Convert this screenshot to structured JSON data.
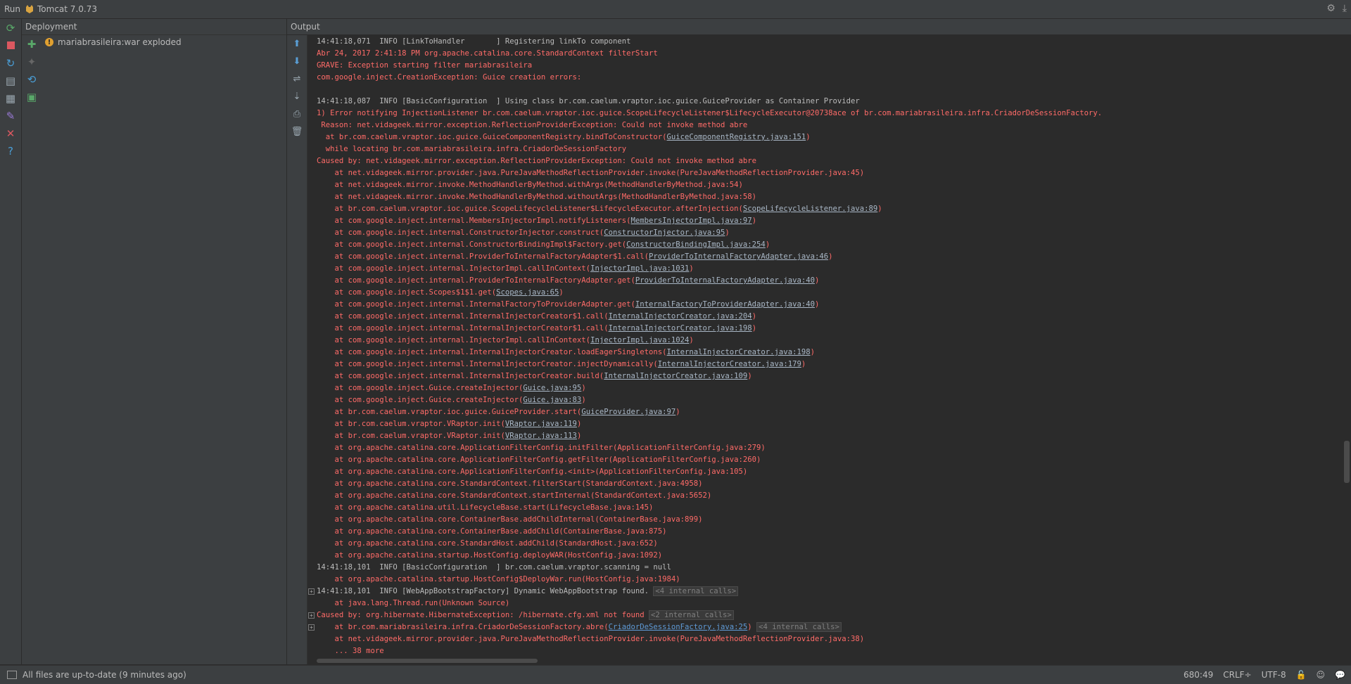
{
  "window": {
    "run_label": "Run",
    "config_name": "Tomcat 7.0.73"
  },
  "deployment": {
    "header": "Deployment",
    "items": [
      {
        "label": "mariabrasileira:war exploded"
      }
    ]
  },
  "output": {
    "header": "Output"
  },
  "console": [
    {
      "cls": "info",
      "text": "14:41:18,071  INFO [LinkToHandler       ] Registering linkTo component"
    },
    {
      "cls": "err",
      "text": "Abr 24, 2017 2:41:18 PM org.apache.catalina.core.StandardContext filterStart"
    },
    {
      "cls": "err",
      "text": "GRAVE: Exception starting filter mariabrasileira"
    },
    {
      "cls": "err",
      "text": "com.google.inject.CreationException: Guice creation errors:"
    },
    {
      "cls": "err",
      "text": ""
    },
    {
      "cls": "info",
      "text": "14:41:18,087  INFO [BasicConfiguration  ] Using class br.com.caelum.vraptor.ioc.guice.GuiceProvider as Container Provider"
    },
    {
      "cls": "err",
      "text": "1) Error notifying InjectionListener br.com.caelum.vraptor.ioc.guice.ScopeLifecycleListener$LifecycleExecutor@20738ace of br.com.mariabrasileira.infra.CriadorDeSessionFactory."
    },
    {
      "cls": "err",
      "text": " Reason: net.vidageek.mirror.exception.ReflectionProviderException: Could not invoke method abre"
    },
    {
      "cls": "err",
      "text": "  at br.com.caelum.vraptor.ioc.guice.GuiceComponentRegistry.bindToConstructor(",
      "link": "GuiceComponentRegistry.java:151",
      "tail": ")"
    },
    {
      "cls": "err",
      "text": "  while locating br.com.mariabrasileira.infra.CriadorDeSessionFactory"
    },
    {
      "cls": "err",
      "text": "Caused by: net.vidageek.mirror.exception.ReflectionProviderException: Could not invoke method abre"
    },
    {
      "cls": "err",
      "text": "    at net.vidageek.mirror.provider.java.PureJavaMethodReflectionProvider.invoke(PureJavaMethodReflectionProvider.java:45)"
    },
    {
      "cls": "err",
      "text": "    at net.vidageek.mirror.invoke.MethodHandlerByMethod.withArgs(MethodHandlerByMethod.java:54)"
    },
    {
      "cls": "err",
      "text": "    at net.vidageek.mirror.invoke.MethodHandlerByMethod.withoutArgs(MethodHandlerByMethod.java:58)"
    },
    {
      "cls": "err",
      "text": "    at br.com.caelum.vraptor.ioc.guice.ScopeLifecycleListener$LifecycleExecutor.afterInjection(",
      "link": "ScopeLifecycleListener.java:89",
      "tail": ")"
    },
    {
      "cls": "err",
      "text": "    at com.google.inject.internal.MembersInjectorImpl.notifyListeners(",
      "link": "MembersInjectorImpl.java:97",
      "tail": ")"
    },
    {
      "cls": "err",
      "text": "    at com.google.inject.internal.ConstructorInjector.construct(",
      "link": "ConstructorInjector.java:95",
      "tail": ")"
    },
    {
      "cls": "err",
      "text": "    at com.google.inject.internal.ConstructorBindingImpl$Factory.get(",
      "link": "ConstructorBindingImpl.java:254",
      "tail": ")"
    },
    {
      "cls": "err",
      "text": "    at com.google.inject.internal.ProviderToInternalFactoryAdapter$1.call(",
      "link": "ProviderToInternalFactoryAdapter.java:46",
      "tail": ")"
    },
    {
      "cls": "err",
      "text": "    at com.google.inject.internal.InjectorImpl.callInContext(",
      "link": "InjectorImpl.java:1031",
      "tail": ")"
    },
    {
      "cls": "err",
      "text": "    at com.google.inject.internal.ProviderToInternalFactoryAdapter.get(",
      "link": "ProviderToInternalFactoryAdapter.java:40",
      "tail": ")"
    },
    {
      "cls": "err",
      "text": "    at com.google.inject.Scopes$1$1.get(",
      "link": "Scopes.java:65",
      "tail": ")"
    },
    {
      "cls": "err",
      "text": "    at com.google.inject.internal.InternalFactoryToProviderAdapter.get(",
      "link": "InternalFactoryToProviderAdapter.java:40",
      "tail": ")"
    },
    {
      "cls": "err",
      "text": "    at com.google.inject.internal.InternalInjectorCreator$1.call(",
      "link": "InternalInjectorCreator.java:204",
      "tail": ")"
    },
    {
      "cls": "err",
      "text": "    at com.google.inject.internal.InternalInjectorCreator$1.call(",
      "link": "InternalInjectorCreator.java:198",
      "tail": ")"
    },
    {
      "cls": "err",
      "text": "    at com.google.inject.internal.InjectorImpl.callInContext(",
      "link": "InjectorImpl.java:1024",
      "tail": ")"
    },
    {
      "cls": "err",
      "text": "    at com.google.inject.internal.InternalInjectorCreator.loadEagerSingletons(",
      "link": "InternalInjectorCreator.java:198",
      "tail": ")"
    },
    {
      "cls": "err",
      "text": "    at com.google.inject.internal.InternalInjectorCreator.injectDynamically(",
      "link": "InternalInjectorCreator.java:179",
      "tail": ")"
    },
    {
      "cls": "err",
      "text": "    at com.google.inject.internal.InternalInjectorCreator.build(",
      "link": "InternalInjectorCreator.java:109",
      "tail": ")"
    },
    {
      "cls": "err",
      "text": "    at com.google.inject.Guice.createInjector(",
      "link": "Guice.java:95",
      "tail": ")"
    },
    {
      "cls": "err",
      "text": "    at com.google.inject.Guice.createInjector(",
      "link": "Guice.java:83",
      "tail": ")"
    },
    {
      "cls": "err",
      "text": "    at br.com.caelum.vraptor.ioc.guice.GuiceProvider.start(",
      "link": "GuiceProvider.java:97",
      "tail": ")"
    },
    {
      "cls": "err",
      "text": "    at br.com.caelum.vraptor.VRaptor.init(",
      "link": "VRaptor.java:119",
      "tail": ")"
    },
    {
      "cls": "err",
      "text": "    at br.com.caelum.vraptor.VRaptor.init(",
      "link": "VRaptor.java:113",
      "tail": ")"
    },
    {
      "cls": "err",
      "text": "    at org.apache.catalina.core.ApplicationFilterConfig.initFilter(ApplicationFilterConfig.java:279)"
    },
    {
      "cls": "err",
      "text": "    at org.apache.catalina.core.ApplicationFilterConfig.getFilter(ApplicationFilterConfig.java:260)"
    },
    {
      "cls": "err",
      "text": "    at org.apache.catalina.core.ApplicationFilterConfig.<init>(ApplicationFilterConfig.java:105)"
    },
    {
      "cls": "err",
      "text": "    at org.apache.catalina.core.StandardContext.filterStart(StandardContext.java:4958)"
    },
    {
      "cls": "err",
      "text": "    at org.apache.catalina.core.StandardContext.startInternal(StandardContext.java:5652)"
    },
    {
      "cls": "err",
      "text": "    at org.apache.catalina.util.LifecycleBase.start(LifecycleBase.java:145)"
    },
    {
      "cls": "err",
      "text": "    at org.apache.catalina.core.ContainerBase.addChildInternal(ContainerBase.java:899)"
    },
    {
      "cls": "err",
      "text": "    at org.apache.catalina.core.ContainerBase.addChild(ContainerBase.java:875)"
    },
    {
      "cls": "err",
      "text": "    at org.apache.catalina.core.StandardHost.addChild(StandardHost.java:652)"
    },
    {
      "cls": "err",
      "text": "    at org.apache.catalina.startup.HostConfig.deployWAR(HostConfig.java:1092)"
    },
    {
      "cls": "info",
      "text": "14:41:18,101  INFO [BasicConfiguration  ] br.com.caelum.vraptor.scanning = null"
    },
    {
      "cls": "err",
      "text": "    at org.apache.catalina.startup.HostConfig$DeployWar.run(HostConfig.java:1984)"
    },
    {
      "cls": "info",
      "plus": true,
      "text": "14:41:18,101  INFO [WebAppBootstrapFactory] Dynamic WebAppBootstrap found.",
      "fold": "<4 internal calls>"
    },
    {
      "cls": "err",
      "text": "    at java.lang.Thread.run(Unknown Source)"
    },
    {
      "cls": "err",
      "plus": true,
      "text": "Caused by: org.hibernate.HibernateException: /hibernate.cfg.xml not found",
      "fold": "<2 internal calls>"
    },
    {
      "cls": "err",
      "plus": true,
      "text": "    at br.com.mariabrasileira.infra.CriadorDeSessionFactory.abre(",
      "link": "CriadorDeSessionFactory.java:25",
      "linkBlue": true,
      "tail": ")",
      "fold": "<4 internal calls>"
    },
    {
      "cls": "err",
      "text": "    at net.vidageek.mirror.provider.java.PureJavaMethodReflectionProvider.invoke(PureJavaMethodReflectionProvider.java:38)"
    },
    {
      "cls": "err",
      "text": "    ... 38 more"
    }
  ],
  "status": {
    "message": "All files are up-to-date (9 minutes ago)",
    "position": "680:49",
    "line_sep": "CRLF÷",
    "encoding": "UTF-8"
  }
}
